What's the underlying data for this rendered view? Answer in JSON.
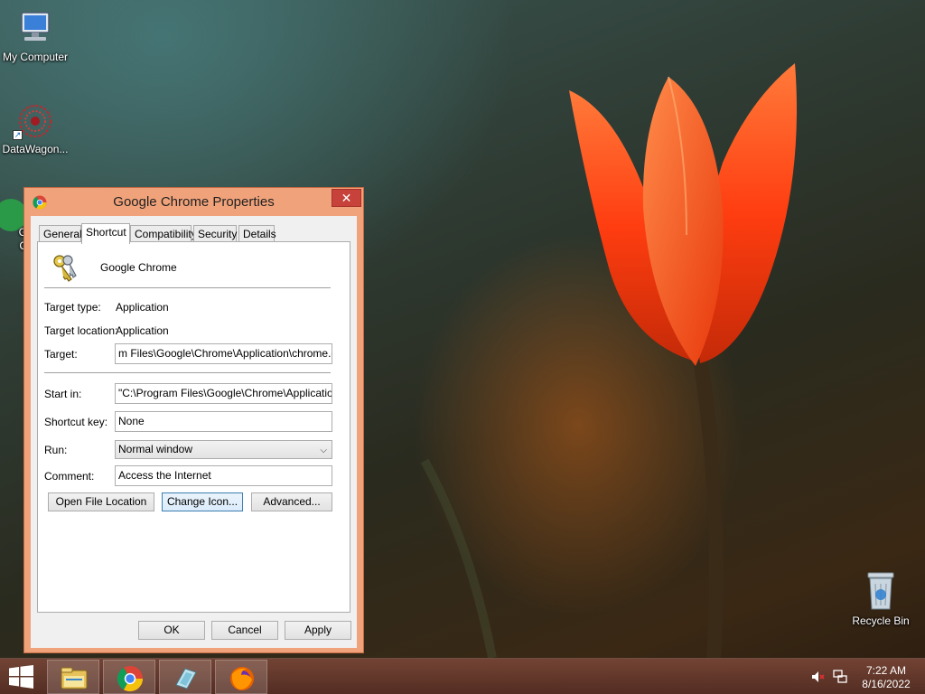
{
  "desktop": {
    "icons": [
      {
        "label": "My Computer",
        "icon": "computer-icon"
      },
      {
        "label": "DataWagon...",
        "icon": "datawagon-icon"
      },
      {
        "label": "G\nC",
        "icon": "chrome-icon"
      },
      {
        "label": "Recycle Bin",
        "icon": "recycle-bin-icon"
      }
    ]
  },
  "dialog": {
    "title": "Google Chrome Properties",
    "close_glyph": "✕",
    "tabs": [
      {
        "label": "General",
        "active": false
      },
      {
        "label": "Shortcut",
        "active": true
      },
      {
        "label": "Compatibility",
        "active": false
      },
      {
        "label": "Security",
        "active": false
      },
      {
        "label": "Details",
        "active": false
      }
    ],
    "shortcut": {
      "name": "Google Chrome",
      "target_type_label": "Target type:",
      "target_type_value": "Application",
      "target_location_label": "Target location:",
      "target_location_value": "Application",
      "target_label": "Target:",
      "target_value": "m Files\\Google\\Chrome\\Application\\chrome.exe\"",
      "start_in_label": "Start in:",
      "start_in_value": "\"C:\\Program Files\\Google\\Chrome\\Application\"",
      "shortcut_key_label": "Shortcut key:",
      "shortcut_key_value": "None",
      "run_label": "Run:",
      "run_value": "Normal window",
      "comment_label": "Comment:",
      "comment_value": "Access the Internet",
      "open_file_location": "Open File Location",
      "change_icon": "Change Icon...",
      "advanced": "Advanced..."
    },
    "footer": {
      "ok": "OK",
      "cancel": "Cancel",
      "apply": "Apply"
    }
  },
  "taskbar": {
    "pinned": [
      "file-explorer-icon",
      "chrome-icon",
      "control-panel-icon",
      "firefox-icon"
    ],
    "clock_time": "7:22 AM",
    "clock_date": "8/16/2022"
  }
}
